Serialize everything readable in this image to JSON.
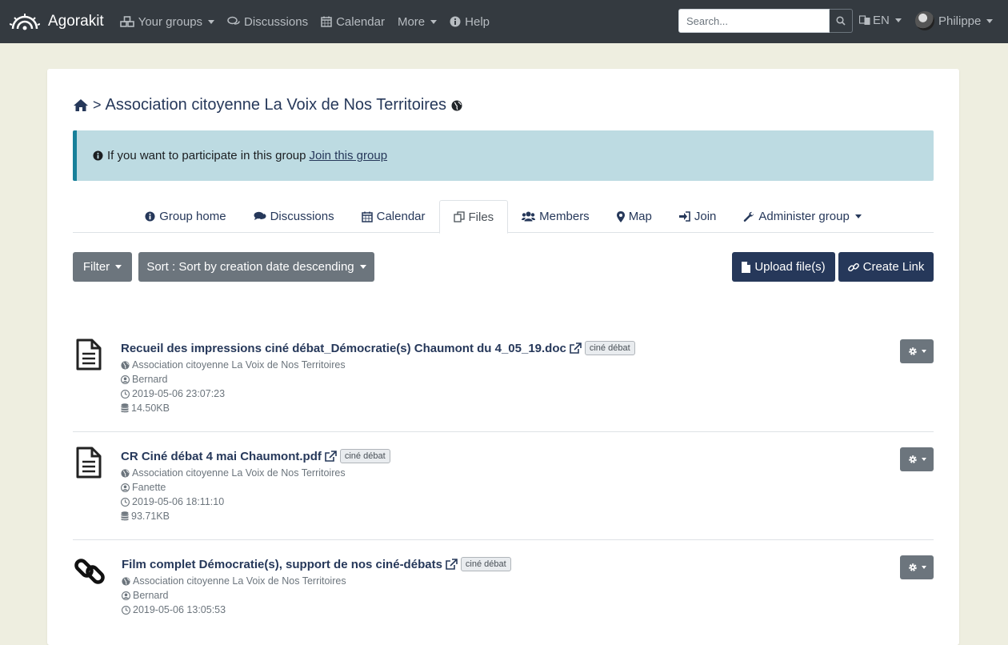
{
  "navbar": {
    "brand": "Agorakit",
    "items": [
      {
        "label": "Your groups",
        "icon": "cubes-icon",
        "dropdown": true
      },
      {
        "label": "Discussions",
        "icon": "comments-icon",
        "dropdown": false
      },
      {
        "label": "Calendar",
        "icon": "calendar-icon",
        "dropdown": false
      },
      {
        "label": "More",
        "icon": "",
        "dropdown": true
      },
      {
        "label": "Help",
        "icon": "info-circle-icon",
        "dropdown": false
      }
    ],
    "search_placeholder": "Search...",
    "language": "EN",
    "user": "Philippe"
  },
  "breadcrumb": {
    "title": "Association citoyenne La Voix de Nos Territoires",
    "separator": ">"
  },
  "alert": {
    "text": "If you want to participate in this group",
    "link": "Join this group"
  },
  "tabs": [
    {
      "label": "Group home",
      "icon": "info-circle-icon"
    },
    {
      "label": "Discussions",
      "icon": "comments-icon"
    },
    {
      "label": "Calendar",
      "icon": "calendar-icon"
    },
    {
      "label": "Files",
      "icon": "files-icon",
      "active": true
    },
    {
      "label": "Members",
      "icon": "users-icon"
    },
    {
      "label": "Map",
      "icon": "map-marker-icon"
    },
    {
      "label": "Join",
      "icon": "sign-in-icon"
    },
    {
      "label": "Administer group",
      "icon": "wrench-icon",
      "dropdown": true
    }
  ],
  "toolbar": {
    "filter": "Filter",
    "sort": "Sort : Sort by creation date descending",
    "upload": "Upload file(s)",
    "create_link": "Create Link"
  },
  "files": [
    {
      "title": "Recueil des impressions ciné débat_Démocratie(s) Chaumont du 4_05_19.doc",
      "tag": "ciné débat",
      "group": "Association citoyenne La Voix de Nos Territoires",
      "author": "Bernard",
      "date": "2019-05-06 23:07:23",
      "size": "14.50KB",
      "type": "document"
    },
    {
      "title": "CR Ciné débat 4 mai Chaumont.pdf",
      "tag": "ciné débat",
      "group": "Association citoyenne La Voix de Nos Territoires",
      "author": "Fanette",
      "date": "2019-05-06 18:11:10",
      "size": "93.71KB",
      "type": "document"
    },
    {
      "title": "Film complet Démocratie(s), support de nos ciné-débats",
      "tag": "ciné débat",
      "group": "Association citoyenne La Voix de Nos Territoires",
      "author": "Bernard",
      "date": "2019-05-06 13:05:53",
      "type": "link"
    }
  ],
  "colors": {
    "navbar": "#343a40",
    "primary": "#26385a",
    "alert_bg": "#bddbe2",
    "alert_border": "#17809a",
    "grey_button": "#6c757d",
    "page_bg": "#eeeee0"
  }
}
